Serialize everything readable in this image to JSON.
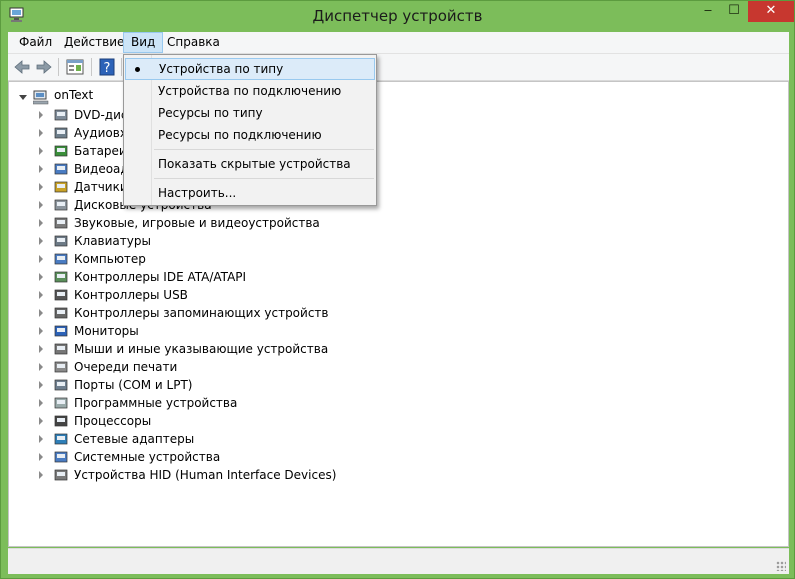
{
  "window": {
    "title": "Диспетчер устройств",
    "min_glyph": "‒",
    "max_glyph": "☐",
    "close_glyph": "✕",
    "accent": "#7cbd5a"
  },
  "menu": [
    {
      "label": "Файл"
    },
    {
      "label": "Действие"
    },
    {
      "label": "Вид"
    },
    {
      "label": "Справка"
    }
  ],
  "toolbar": [
    "back-arrow-icon",
    "forward-arrow-icon",
    "properties-icon",
    "help-icon",
    "computer-icon"
  ],
  "tree": {
    "root": "onText",
    "items": [
      {
        "label": "DVD-диск",
        "icon": "dvd-drive-icon"
      },
      {
        "label": "Аудиовхо",
        "icon": "audio-icon"
      },
      {
        "label": "Батареи",
        "icon": "battery-icon"
      },
      {
        "label": "Видеоада",
        "icon": "display-adapter-icon"
      },
      {
        "label": "Датчики",
        "icon": "sensor-icon"
      },
      {
        "label": "Дисковые устройства",
        "icon": "disk-drive-icon"
      },
      {
        "label": "Звуковые, игровые и видеоустройства",
        "icon": "speaker-icon"
      },
      {
        "label": "Клавиатуры",
        "icon": "keyboard-icon"
      },
      {
        "label": "Компьютер",
        "icon": "computer-icon"
      },
      {
        "label": "Контроллеры IDE ATA/ATAPI",
        "icon": "ide-controller-icon"
      },
      {
        "label": "Контроллеры USB",
        "icon": "usb-icon"
      },
      {
        "label": "Контроллеры запоминающих устройств",
        "icon": "storage-controller-icon"
      },
      {
        "label": "Мониторы",
        "icon": "monitor-icon"
      },
      {
        "label": "Мыши и иные указывающие устройства",
        "icon": "mouse-icon"
      },
      {
        "label": "Очереди печати",
        "icon": "printer-icon"
      },
      {
        "label": "Порты (COM и LPT)",
        "icon": "port-icon"
      },
      {
        "label": "Программные устройства",
        "icon": "software-device-icon"
      },
      {
        "label": "Процессоры",
        "icon": "processor-icon"
      },
      {
        "label": "Сетевые адаптеры",
        "icon": "network-adapter-icon"
      },
      {
        "label": "Системные устройства",
        "icon": "system-device-icon"
      },
      {
        "label": "Устройства HID (Human Interface Devices)",
        "icon": "hid-icon"
      }
    ]
  },
  "view_menu": {
    "items": [
      {
        "label": "Устройства по типу",
        "checked": true
      },
      {
        "label": "Устройства по подключению"
      },
      {
        "label": "Ресурсы по типу"
      },
      {
        "label": "Ресурсы по подключению"
      },
      {
        "label": "Показать скрытые устройства"
      },
      {
        "label": "Настроить..."
      }
    ]
  }
}
